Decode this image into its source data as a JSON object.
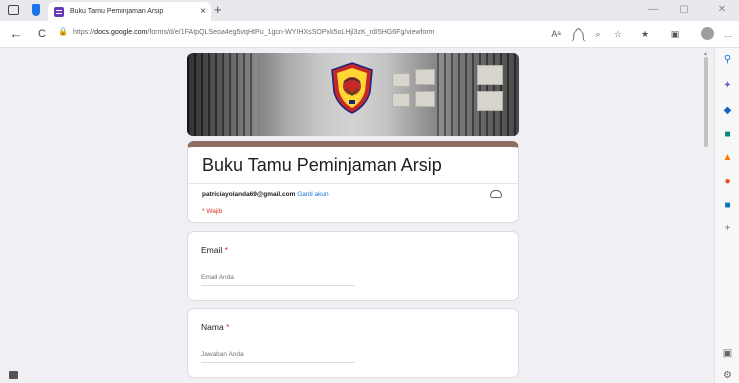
{
  "browser": {
    "tab_title": "Buku Tamu Peminjaman Arsip",
    "tab_close": "×",
    "new_tab": "+",
    "window_controls": [
      "—",
      "▢",
      "✕"
    ],
    "nav": {
      "back": "←",
      "refresh": "C"
    },
    "url_prefix": "https://",
    "url_domain": "docs.google.com",
    "url_path": "/forms/d/e/1FAIpQLSeoa4eg5vqHtPu_1gcn-WYIHXsSOPxk5oLHjl3zK_rdI5HG6Fg/viewform",
    "toolbar_icons": {
      "read_aloud": "Aᵃ",
      "immersive": "༼༽",
      "zoom": "⌕",
      "favorite": "☆",
      "favorites": "★",
      "collections": "▣",
      "more": "…"
    }
  },
  "form": {
    "title": "Buku Tamu Peminjaman Arsip",
    "account_email": "patriciayolanda69@gmail.com",
    "switch_account": "Ganti akun",
    "required_note": "* Wajib",
    "questions": [
      {
        "label": "Email",
        "required": "*",
        "placeholder": "Email Anda"
      },
      {
        "label": "Nama",
        "required": "*",
        "placeholder": "Jawaban Anda"
      }
    ]
  },
  "sidebar_icons": [
    "search-icon",
    "sparkle-icon",
    "tag-icon",
    "briefcase-icon",
    "games-icon",
    "office-icon",
    "outlook-icon",
    "add-icon"
  ],
  "colors": {
    "header_accent": "#8d6e63",
    "link": "#1a73e8",
    "required": "#d93025"
  }
}
